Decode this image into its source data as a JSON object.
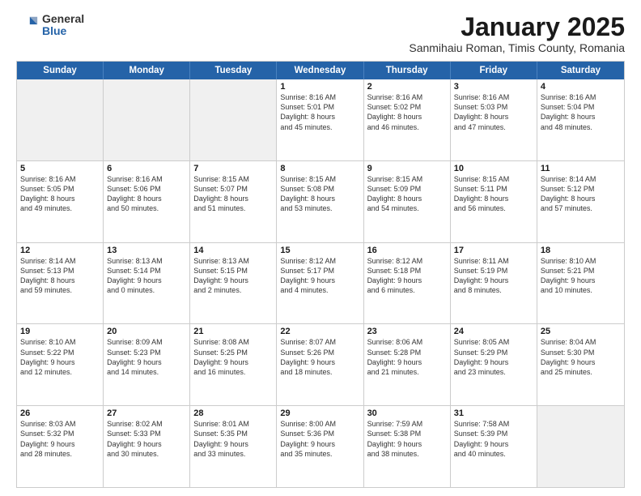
{
  "logo": {
    "general": "General",
    "blue": "Blue"
  },
  "title": "January 2025",
  "subtitle": "Sanmihaiu Roman, Timis County, Romania",
  "days": [
    "Sunday",
    "Monday",
    "Tuesday",
    "Wednesday",
    "Thursday",
    "Friday",
    "Saturday"
  ],
  "weeks": [
    [
      {
        "num": "",
        "text": ""
      },
      {
        "num": "",
        "text": ""
      },
      {
        "num": "",
        "text": ""
      },
      {
        "num": "1",
        "text": "Sunrise: 8:16 AM\nSunset: 5:01 PM\nDaylight: 8 hours\nand 45 minutes."
      },
      {
        "num": "2",
        "text": "Sunrise: 8:16 AM\nSunset: 5:02 PM\nDaylight: 8 hours\nand 46 minutes."
      },
      {
        "num": "3",
        "text": "Sunrise: 8:16 AM\nSunset: 5:03 PM\nDaylight: 8 hours\nand 47 minutes."
      },
      {
        "num": "4",
        "text": "Sunrise: 8:16 AM\nSunset: 5:04 PM\nDaylight: 8 hours\nand 48 minutes."
      }
    ],
    [
      {
        "num": "5",
        "text": "Sunrise: 8:16 AM\nSunset: 5:05 PM\nDaylight: 8 hours\nand 49 minutes."
      },
      {
        "num": "6",
        "text": "Sunrise: 8:16 AM\nSunset: 5:06 PM\nDaylight: 8 hours\nand 50 minutes."
      },
      {
        "num": "7",
        "text": "Sunrise: 8:15 AM\nSunset: 5:07 PM\nDaylight: 8 hours\nand 51 minutes."
      },
      {
        "num": "8",
        "text": "Sunrise: 8:15 AM\nSunset: 5:08 PM\nDaylight: 8 hours\nand 53 minutes."
      },
      {
        "num": "9",
        "text": "Sunrise: 8:15 AM\nSunset: 5:09 PM\nDaylight: 8 hours\nand 54 minutes."
      },
      {
        "num": "10",
        "text": "Sunrise: 8:15 AM\nSunset: 5:11 PM\nDaylight: 8 hours\nand 56 minutes."
      },
      {
        "num": "11",
        "text": "Sunrise: 8:14 AM\nSunset: 5:12 PM\nDaylight: 8 hours\nand 57 minutes."
      }
    ],
    [
      {
        "num": "12",
        "text": "Sunrise: 8:14 AM\nSunset: 5:13 PM\nDaylight: 8 hours\nand 59 minutes."
      },
      {
        "num": "13",
        "text": "Sunrise: 8:13 AM\nSunset: 5:14 PM\nDaylight: 9 hours\nand 0 minutes."
      },
      {
        "num": "14",
        "text": "Sunrise: 8:13 AM\nSunset: 5:15 PM\nDaylight: 9 hours\nand 2 minutes."
      },
      {
        "num": "15",
        "text": "Sunrise: 8:12 AM\nSunset: 5:17 PM\nDaylight: 9 hours\nand 4 minutes."
      },
      {
        "num": "16",
        "text": "Sunrise: 8:12 AM\nSunset: 5:18 PM\nDaylight: 9 hours\nand 6 minutes."
      },
      {
        "num": "17",
        "text": "Sunrise: 8:11 AM\nSunset: 5:19 PM\nDaylight: 9 hours\nand 8 minutes."
      },
      {
        "num": "18",
        "text": "Sunrise: 8:10 AM\nSunset: 5:21 PM\nDaylight: 9 hours\nand 10 minutes."
      }
    ],
    [
      {
        "num": "19",
        "text": "Sunrise: 8:10 AM\nSunset: 5:22 PM\nDaylight: 9 hours\nand 12 minutes."
      },
      {
        "num": "20",
        "text": "Sunrise: 8:09 AM\nSunset: 5:23 PM\nDaylight: 9 hours\nand 14 minutes."
      },
      {
        "num": "21",
        "text": "Sunrise: 8:08 AM\nSunset: 5:25 PM\nDaylight: 9 hours\nand 16 minutes."
      },
      {
        "num": "22",
        "text": "Sunrise: 8:07 AM\nSunset: 5:26 PM\nDaylight: 9 hours\nand 18 minutes."
      },
      {
        "num": "23",
        "text": "Sunrise: 8:06 AM\nSunset: 5:28 PM\nDaylight: 9 hours\nand 21 minutes."
      },
      {
        "num": "24",
        "text": "Sunrise: 8:05 AM\nSunset: 5:29 PM\nDaylight: 9 hours\nand 23 minutes."
      },
      {
        "num": "25",
        "text": "Sunrise: 8:04 AM\nSunset: 5:30 PM\nDaylight: 9 hours\nand 25 minutes."
      }
    ],
    [
      {
        "num": "26",
        "text": "Sunrise: 8:03 AM\nSunset: 5:32 PM\nDaylight: 9 hours\nand 28 minutes."
      },
      {
        "num": "27",
        "text": "Sunrise: 8:02 AM\nSunset: 5:33 PM\nDaylight: 9 hours\nand 30 minutes."
      },
      {
        "num": "28",
        "text": "Sunrise: 8:01 AM\nSunset: 5:35 PM\nDaylight: 9 hours\nand 33 minutes."
      },
      {
        "num": "29",
        "text": "Sunrise: 8:00 AM\nSunset: 5:36 PM\nDaylight: 9 hours\nand 35 minutes."
      },
      {
        "num": "30",
        "text": "Sunrise: 7:59 AM\nSunset: 5:38 PM\nDaylight: 9 hours\nand 38 minutes."
      },
      {
        "num": "31",
        "text": "Sunrise: 7:58 AM\nSunset: 5:39 PM\nDaylight: 9 hours\nand 40 minutes."
      },
      {
        "num": "",
        "text": ""
      }
    ]
  ]
}
